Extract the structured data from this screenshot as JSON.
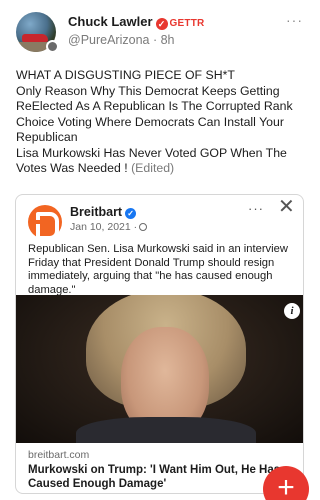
{
  "post": {
    "author_name": "Chuck Lawler",
    "platform_label": "GETTR",
    "handle": "@PureArizona",
    "time_ago": "8h",
    "text_lines": [
      "WHAT A DISGUSTING PIECE OF SH*T",
      "Only Reason Why This Democrat Keeps Getting",
      "ReElected As A Republican Is The Corrupted Rank",
      "Choice Voting Where Democrats Can Install Your",
      "Republican",
      "Lisa Murkowski Has Never Voted GOP When The",
      "Votes Was Needed !"
    ],
    "edited_label": "(Edited)",
    "more_icon": "more-horizontal-icon"
  },
  "embed": {
    "source_name": "Breitbart",
    "date": "Jan 10, 2021 ·",
    "text_lines": [
      "Republican Sen. Lisa Murkowski said in an interview",
      "Friday that President Donald Trump should resign",
      "immediately, arguing that \"he has caused enough",
      "damage.\""
    ],
    "link_domain": "breitbart.com",
    "link_title_lines": [
      "Murkowski on Trump: 'I Want Him Out, He Has",
      "Caused Enough Damage'"
    ],
    "more_symbol": "···",
    "close_symbol": "✕",
    "info_symbol": "i"
  },
  "fab": {
    "symbol": "+"
  },
  "colors": {
    "accent_red": "#e8372f",
    "breitbart_orange": "#f26522",
    "verified_blue": "#1877f2"
  }
}
